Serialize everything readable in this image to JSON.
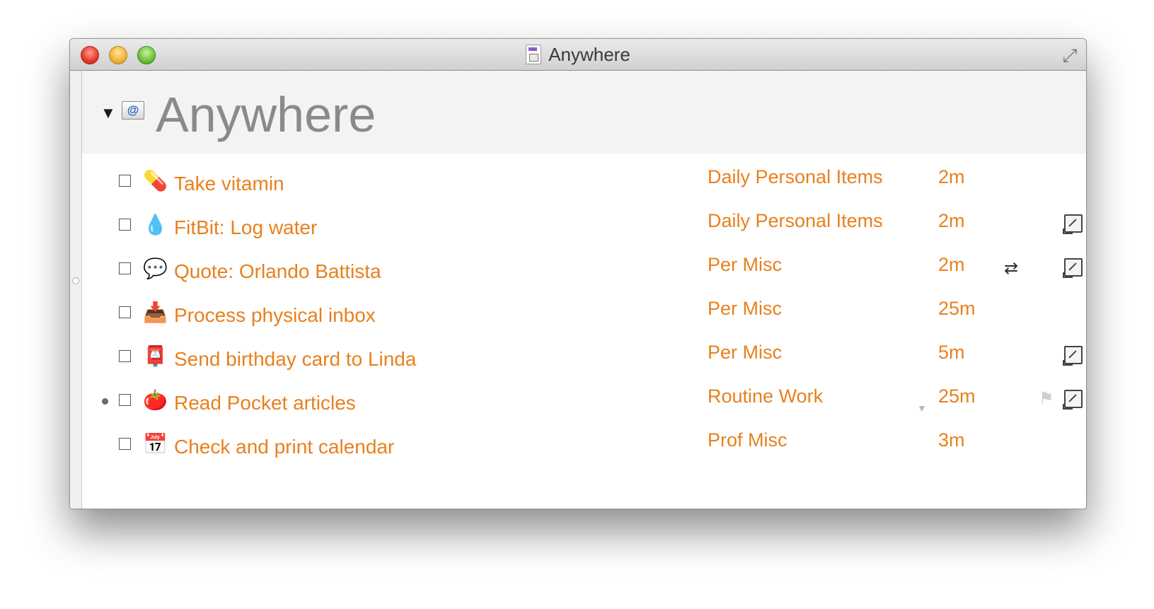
{
  "window": {
    "title": "Anywhere"
  },
  "context": {
    "title": "Anywhere",
    "icon": "at-sign-context-icon"
  },
  "colors": {
    "task_text": "#e8801d",
    "header_bg": "#f3f3f3",
    "context_title": "#8a8a8a"
  },
  "tasks": [
    {
      "emoji": "💊",
      "icon": "pill-icon",
      "label": "Take vitamin",
      "project": "Daily Personal Items",
      "duration": "2m",
      "repeat": false,
      "flag": false,
      "note": false,
      "bullet": false
    },
    {
      "emoji": "💧",
      "icon": "water-drop-icon",
      "label": "FitBit: Log water",
      "project": "Daily Personal Items",
      "duration": "2m",
      "repeat": false,
      "flag": false,
      "note": true,
      "bullet": false
    },
    {
      "emoji": "💬",
      "icon": "speech-bubble-icon",
      "label": "Quote: Orlando Battista",
      "project": "Per Misc",
      "duration": "2m",
      "repeat": true,
      "flag": false,
      "note": true,
      "bullet": false
    },
    {
      "emoji": "📥",
      "icon": "inbox-tray-icon",
      "label": "Process physical inbox",
      "project": "Per Misc",
      "duration": "25m",
      "repeat": false,
      "flag": false,
      "note": false,
      "bullet": false
    },
    {
      "emoji": "📮",
      "icon": "postbox-icon",
      "label": "Send birthday card to Linda",
      "project": "Per Misc",
      "duration": "5m",
      "repeat": false,
      "flag": false,
      "note": true,
      "bullet": false
    },
    {
      "emoji": "🍅",
      "icon": "tomato-icon",
      "label": "Read Pocket articles",
      "project": "Routine Work",
      "duration": "25m",
      "repeat": false,
      "flag": true,
      "note": true,
      "bullet": true
    },
    {
      "emoji": "📅",
      "icon": "calendar-icon",
      "label": "Check and print calendar",
      "project": "Prof Misc",
      "duration": "3m",
      "repeat": false,
      "flag": false,
      "note": false,
      "bullet": false
    }
  ]
}
